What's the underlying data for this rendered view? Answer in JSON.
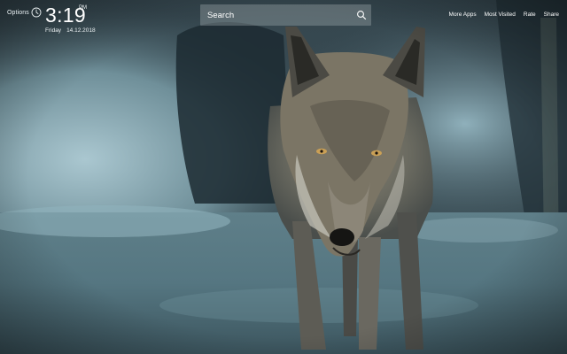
{
  "header": {
    "options_label": "Options",
    "time": "3:19",
    "ampm": "PM",
    "day": "Friday",
    "date": "14.12.2018"
  },
  "search": {
    "placeholder": "Search"
  },
  "nav": {
    "more_apps": "More Apps",
    "most_visited": "Most Visited",
    "rate": "Rate",
    "share": "Share"
  },
  "icons": {
    "clock": "clock-icon",
    "search": "search-icon"
  },
  "colors": {
    "search_bg": "#a0aaae",
    "text": "#ffffff"
  }
}
